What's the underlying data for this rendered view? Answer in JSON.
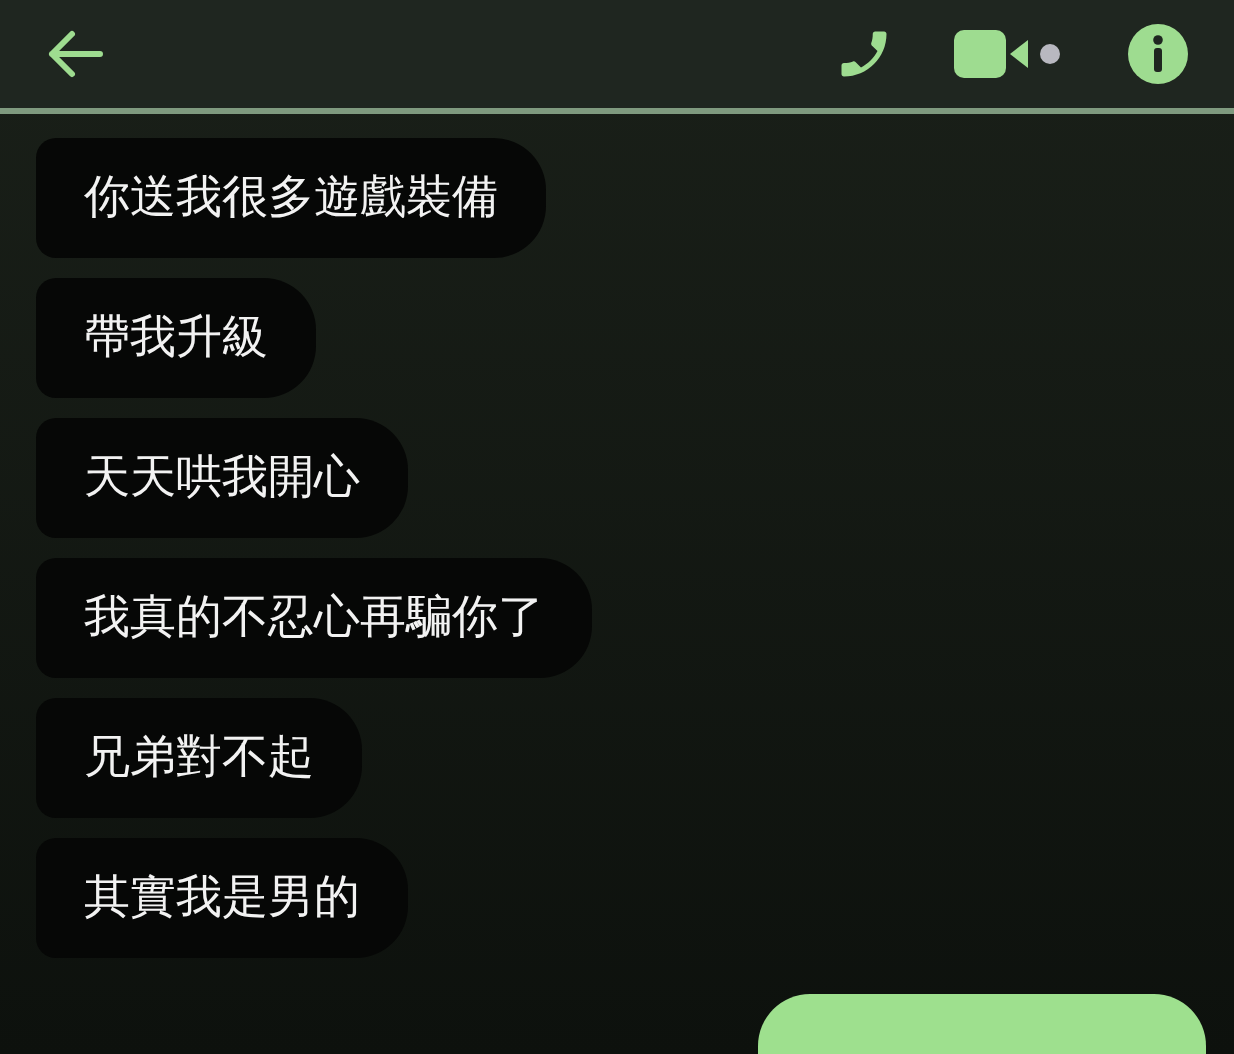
{
  "header": {
    "has_back": true
  },
  "messages": [
    {
      "kind": "incoming",
      "text": "你送我很多遊戲裝備"
    },
    {
      "kind": "incoming",
      "text": "帶我升級"
    },
    {
      "kind": "incoming",
      "text": "天天哄我開心"
    },
    {
      "kind": "incoming",
      "text": "我真的不忍心再騙你了"
    },
    {
      "kind": "incoming",
      "text": "兄弟對不起"
    },
    {
      "kind": "incoming",
      "text": "其實我是男的"
    },
    {
      "kind": "outgoing"
    }
  ]
}
